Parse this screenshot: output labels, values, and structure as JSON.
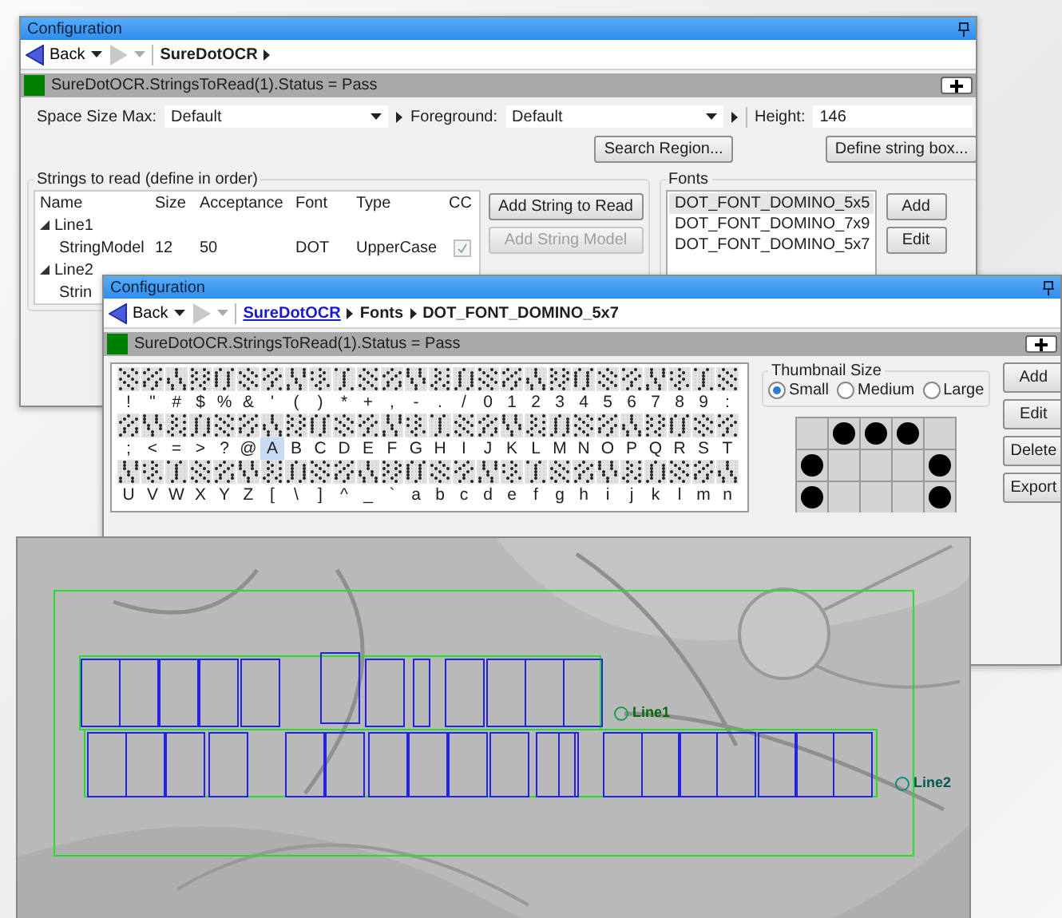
{
  "main_window": {
    "title": "Configuration",
    "back_label": "Back",
    "crumbs": [
      {
        "label": "SureDotOCR",
        "kind": "plain"
      }
    ],
    "status": {
      "text": "SureDotOCR.StringsToRead(1).Status = Pass",
      "color": "#008000"
    },
    "fields": [
      {
        "label": "Space Size Max:",
        "value": "Default",
        "kind": "select"
      },
      {
        "label": "Foreground:",
        "value": "Default",
        "kind": "select"
      },
      {
        "label": "Height:",
        "value": "146",
        "kind": "input"
      }
    ],
    "buttons": [
      "Search Region...",
      "Define string box..."
    ],
    "strings_group": {
      "title": "Strings to read (define in order)",
      "columns": [
        "Name",
        "Size",
        "Acceptance",
        "Font",
        "Type",
        "CC"
      ],
      "rows": [
        {
          "kind": "group",
          "cells": [
            "Line1"
          ],
          "expanded": true
        },
        {
          "kind": "item",
          "cells": [
            "StringModel",
            "12",
            "50",
            "DOT",
            "UpperCase"
          ],
          "checked": true
        },
        {
          "kind": "group",
          "cells": [
            "Line2"
          ],
          "expanded": true
        },
        {
          "kind": "item",
          "cells": [
            "Strin"
          ]
        }
      ],
      "buttons": [
        {
          "label": "Add String to Read",
          "disabled": false
        },
        {
          "label": "Add String Model",
          "disabled": true
        }
      ]
    },
    "fonts_group": {
      "title": "Fonts",
      "items": [
        {
          "label": "DOT_FONT_DOMINO_5x5",
          "selected": true
        },
        {
          "label": "DOT_FONT_DOMINO_7x9",
          "selected": false
        },
        {
          "label": "DOT_FONT_DOMINO_5x7",
          "selected": false
        }
      ],
      "buttons": [
        "Add",
        "Edit"
      ]
    }
  },
  "font_window": {
    "title": "Configuration",
    "back_label": "Back",
    "crumbs": [
      {
        "label": "SureDotOCR",
        "kind": "link"
      },
      {
        "label": "Fonts",
        "kind": "plain"
      },
      {
        "label": "DOT_FONT_DOMINO_5x7",
        "kind": "plain"
      }
    ],
    "status": {
      "text": "SureDotOCR.StringsToRead(1).Status = Pass",
      "color": "#008000"
    },
    "glyph_rows": [
      [
        {
          "char": "!",
          "selected": false
        },
        {
          "char": "\"",
          "selected": false
        },
        {
          "char": "#",
          "selected": false
        },
        {
          "char": "$",
          "selected": false
        },
        {
          "char": "%",
          "selected": false
        },
        {
          "char": "&",
          "selected": false
        },
        {
          "char": "'",
          "selected": false
        },
        {
          "char": "(",
          "selected": false
        },
        {
          "char": ")",
          "selected": false
        },
        {
          "char": "*",
          "selected": false
        },
        {
          "char": "+",
          "selected": false
        },
        {
          "char": ",",
          "selected": false
        },
        {
          "char": "-",
          "selected": false
        },
        {
          "char": ".",
          "selected": false
        },
        {
          "char": "/",
          "selected": false
        },
        {
          "char": "0",
          "selected": false
        },
        {
          "char": "1",
          "selected": false
        },
        {
          "char": "2",
          "selected": false
        },
        {
          "char": "3",
          "selected": false
        },
        {
          "char": "4",
          "selected": false
        },
        {
          "char": "5",
          "selected": false
        },
        {
          "char": "6",
          "selected": false
        },
        {
          "char": "7",
          "selected": false
        },
        {
          "char": "8",
          "selected": false
        },
        {
          "char": "9",
          "selected": false
        },
        {
          "char": ":",
          "selected": false
        }
      ],
      [
        {
          "char": ";",
          "selected": false
        },
        {
          "char": "<",
          "selected": false
        },
        {
          "char": "=",
          "selected": false
        },
        {
          "char": ">",
          "selected": false
        },
        {
          "char": "?",
          "selected": false
        },
        {
          "char": "@",
          "selected": false
        },
        {
          "char": "A",
          "selected": true
        },
        {
          "char": "B",
          "selected": false
        },
        {
          "char": "C",
          "selected": false
        },
        {
          "char": "D",
          "selected": false
        },
        {
          "char": "E",
          "selected": false
        },
        {
          "char": "F",
          "selected": false
        },
        {
          "char": "G",
          "selected": false
        },
        {
          "char": "H",
          "selected": false
        },
        {
          "char": "I",
          "selected": false
        },
        {
          "char": "J",
          "selected": false
        },
        {
          "char": "K",
          "selected": false
        },
        {
          "char": "L",
          "selected": false
        },
        {
          "char": "M",
          "selected": false
        },
        {
          "char": "N",
          "selected": false
        },
        {
          "char": "O",
          "selected": false
        },
        {
          "char": "P",
          "selected": false
        },
        {
          "char": "Q",
          "selected": false
        },
        {
          "char": "R",
          "selected": false
        },
        {
          "char": "S",
          "selected": false
        },
        {
          "char": "T",
          "selected": false
        }
      ],
      [
        {
          "char": "U",
          "selected": false
        },
        {
          "char": "V",
          "selected": false
        },
        {
          "char": "W",
          "selected": false
        },
        {
          "char": "X",
          "selected": false
        },
        {
          "char": "Y",
          "selected": false
        },
        {
          "char": "Z",
          "selected": false
        },
        {
          "char": "[",
          "selected": false
        },
        {
          "char": "\\",
          "selected": false
        },
        {
          "char": "]",
          "selected": false
        },
        {
          "char": "^",
          "selected": false
        },
        {
          "char": "_",
          "selected": false
        },
        {
          "char": "`",
          "selected": false
        },
        {
          "char": "a",
          "selected": false
        },
        {
          "char": "b",
          "selected": false
        },
        {
          "char": "c",
          "selected": false
        },
        {
          "char": "d",
          "selected": false
        },
        {
          "char": "e",
          "selected": false
        },
        {
          "char": "f",
          "selected": false
        },
        {
          "char": "g",
          "selected": false
        },
        {
          "char": "h",
          "selected": false
        },
        {
          "char": "i",
          "selected": false
        },
        {
          "char": "j",
          "selected": false
        },
        {
          "char": "k",
          "selected": false
        },
        {
          "char": "l",
          "selected": false
        },
        {
          "char": "m",
          "selected": false
        },
        {
          "char": "n",
          "selected": false
        }
      ]
    ],
    "thumbnail_size": {
      "title": "Thumbnail Size",
      "options": [
        {
          "label": "Small",
          "selected": true
        },
        {
          "label": "Medium",
          "selected": false
        },
        {
          "label": "Large",
          "selected": false
        }
      ]
    },
    "buttons": [
      "Add",
      "Edit",
      "Delete",
      "Export"
    ]
  },
  "camera_view": {
    "kind": "picture",
    "line_labels": [
      "Line1",
      "Line2"
    ]
  }
}
